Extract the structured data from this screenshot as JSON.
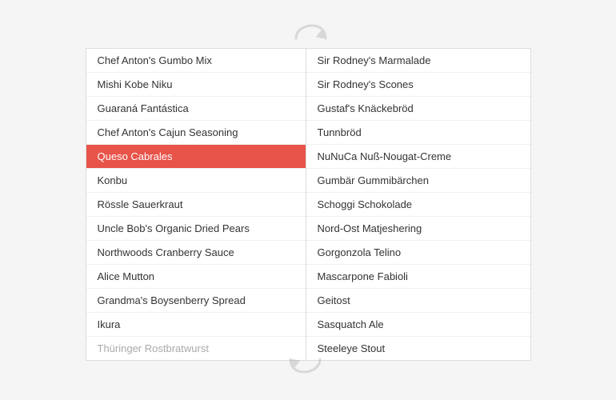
{
  "arrows": {
    "top": "↻",
    "bottom": "↺"
  },
  "leftList": {
    "items": [
      {
        "id": 1,
        "label": "Chef Anton's Gumbo Mix",
        "selected": false
      },
      {
        "id": 2,
        "label": "Mishi Kobe Niku",
        "selected": false
      },
      {
        "id": 3,
        "label": "Guaraná Fantástica",
        "selected": false
      },
      {
        "id": 4,
        "label": "Chef Anton's Cajun Seasoning",
        "selected": false
      },
      {
        "id": 5,
        "label": "Queso Cabrales",
        "selected": true
      },
      {
        "id": 6,
        "label": "Konbu",
        "selected": false
      },
      {
        "id": 7,
        "label": "Rössle Sauerkraut",
        "selected": false
      },
      {
        "id": 8,
        "label": "Uncle Bob's Organic Dried Pears",
        "selected": false
      },
      {
        "id": 9,
        "label": "Northwoods Cranberry Sauce",
        "selected": false
      },
      {
        "id": 10,
        "label": "Alice Mutton",
        "selected": false
      },
      {
        "id": 11,
        "label": "Grandma's Boysenberry Spread",
        "selected": false
      },
      {
        "id": 12,
        "label": "Ikura",
        "selected": false
      },
      {
        "id": 13,
        "label": "Thüringer Rostbratwurst",
        "selected": false,
        "partial": true
      }
    ]
  },
  "rightList": {
    "items": [
      {
        "id": 1,
        "label": "Sir Rodney's Marmalade"
      },
      {
        "id": 2,
        "label": "Sir Rodney's Scones"
      },
      {
        "id": 3,
        "label": "Gustaf's Knäckebröd"
      },
      {
        "id": 4,
        "label": "Tunnbröd"
      },
      {
        "id": 5,
        "label": "NuNuCa Nuß-Nougat-Creme"
      },
      {
        "id": 6,
        "label": "Gumbär Gummibärchen"
      },
      {
        "id": 7,
        "label": "Schoggi Schokolade"
      },
      {
        "id": 8,
        "label": "Nord-Ost Matjeshering"
      },
      {
        "id": 9,
        "label": "Gorgonzola Telino"
      },
      {
        "id": 10,
        "label": "Mascarpone Fabioli"
      },
      {
        "id": 11,
        "label": "Geitost"
      },
      {
        "id": 12,
        "label": "Sasquatch Ale"
      },
      {
        "id": 13,
        "label": "Steeleye Stout"
      }
    ]
  }
}
